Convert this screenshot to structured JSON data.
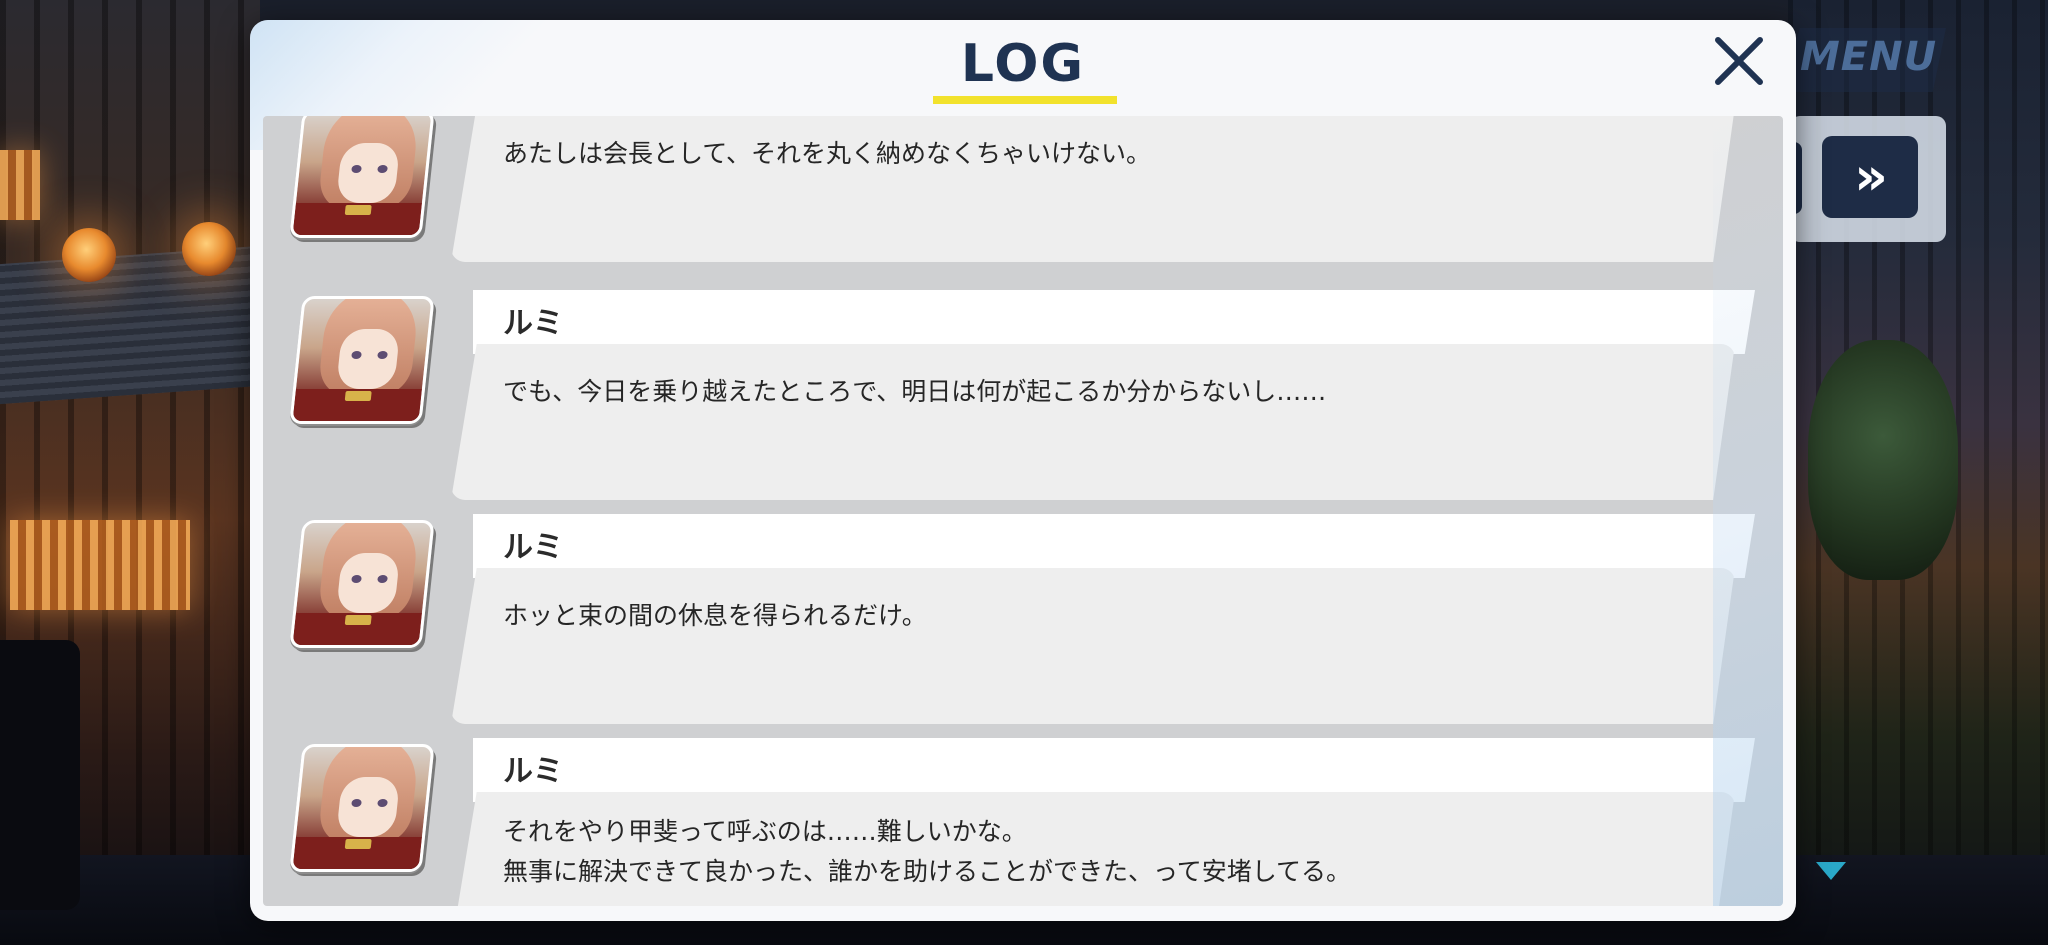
{
  "hud": {
    "menu_label": "MENU",
    "skip_glyph": "»"
  },
  "log": {
    "title": "LOG",
    "close_glyph": "✕",
    "accent_color": "#f2e22c",
    "entries": [
      {
        "speaker": "",
        "lines": [
          "あたしは会長として、それを丸く納めなくちゃいけない。"
        ]
      },
      {
        "speaker": "ルミ",
        "lines": [
          "でも、今日を乗り越えたところで、明日は何が起こるか分からないし……"
        ]
      },
      {
        "speaker": "ルミ",
        "lines": [
          "ホッと束の間の休息を得られるだけ。"
        ]
      },
      {
        "speaker": "ルミ",
        "lines": [
          "それをやり甲斐って呼ぶのは……難しいかな。",
          "無事に解決できて良かった、誰かを助けることができた、って安堵してる。"
        ]
      }
    ]
  }
}
